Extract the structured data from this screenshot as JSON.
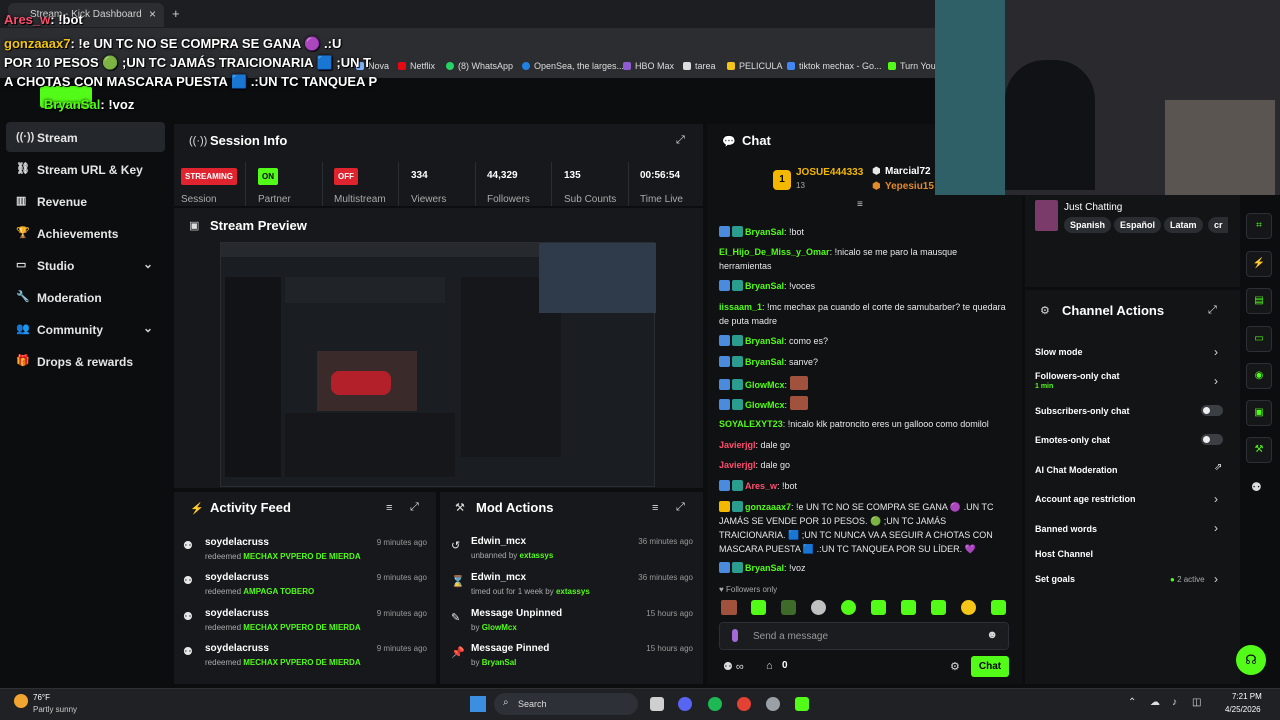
{
  "browser": {
    "tab_title": "Stream - Kick Dashboard",
    "new_tab": "+",
    "close_tab": "×",
    "bookmarks": [
      "Nova",
      "Netflix",
      "(8) WhatsApp",
      "OpenSea, the larges...",
      "HBO Max",
      "tarea",
      "PELICULA",
      "tiktok mechax - Go...",
      "Turn You"
    ]
  },
  "overlay_chat": [
    {
      "name": "Ares_w",
      "text": ": !bot"
    },
    {
      "name": "gonzaaax7",
      "text": ": !e UN TC NO SE COMPRA SE GANA 🟣 .:U"
    },
    {
      "name": "",
      "text": "POR 10 PESOS 🟢 ;UN TC JAMÁS TRAICIONARIA 🟦 ;UN T"
    },
    {
      "name": "",
      "text": "A CHOTAS CON MASCARA PUESTA 🟦 .:UN TC TANQUEA P"
    },
    {
      "name": "BryanSal",
      "text": ": !voz"
    }
  ],
  "sidebar": {
    "items": [
      {
        "label": "Stream",
        "icon": "broadcast-icon",
        "active": true
      },
      {
        "label": "Stream URL & Key",
        "icon": "link-icon"
      },
      {
        "label": "Revenue",
        "icon": "chart-icon"
      },
      {
        "label": "Achievements",
        "icon": "trophy-icon"
      },
      {
        "label": "Studio",
        "icon": "monitor-icon",
        "chevron": true
      },
      {
        "label": "Moderation",
        "icon": "wrench-icon"
      },
      {
        "label": "Community",
        "icon": "people-icon",
        "chevron": true
      },
      {
        "label": "Drops & rewards",
        "icon": "gift-icon"
      }
    ]
  },
  "session_info": {
    "title": "Session Info",
    "session_badge": "STREAMING",
    "session_label": "Session",
    "partner_badge": "ON",
    "partner_label": "Partner",
    "multistream_badge": "OFF",
    "multistream_label": "Multistream",
    "viewers": "334",
    "viewers_label": "Viewers",
    "followers": "44,329",
    "followers_label": "Followers",
    "subs": "135",
    "subs_label": "Sub Counts",
    "time_live": "00:56:54",
    "time_live_label": "Time Live"
  },
  "stream_preview": {
    "title": "Stream Preview"
  },
  "activity_feed": {
    "title": "Activity Feed",
    "items": [
      {
        "user": "soydelacruss",
        "action": "redeemed",
        "reward": "MECHAX PVPERO DE MIERDA",
        "time": "9 minutes ago"
      },
      {
        "user": "soydelacruss",
        "action": "redeemed",
        "reward": "AMPAGA TOBERO",
        "time": "9 minutes ago"
      },
      {
        "user": "soydelacruss",
        "action": "redeemed",
        "reward": "MECHAX PVPERO DE MIERDA",
        "time": "9 minutes ago"
      },
      {
        "user": "soydelacruss",
        "action": "redeemed",
        "reward": "MECHAX PVPERO DE MIERDA",
        "time": "9 minutes ago"
      }
    ]
  },
  "mod_actions": {
    "title": "Mod Actions",
    "items": [
      {
        "title": "Edwin_mcx",
        "detail": "unbanned by",
        "by": "extassys",
        "time": "36 minutes ago",
        "icon": "undo-icon"
      },
      {
        "title": "Edwin_mcx",
        "detail": "timed out for 1 week by",
        "by": "extassys",
        "time": "36 minutes ago",
        "icon": "hourglass-icon"
      },
      {
        "title": "Message Unpinned",
        "detail": "by",
        "by": "GlowMcx",
        "time": "15 hours ago",
        "icon": "unpin-icon"
      },
      {
        "title": "Message Pinned",
        "detail": "by",
        "by": "BryanSal",
        "time": "15 hours ago",
        "icon": "pin-icon"
      }
    ]
  },
  "chat": {
    "title": "Chat",
    "top_gifter": "JOSUE444333",
    "top_gifter_count": "13",
    "top_rank": "1",
    "gifter2": "Marcial72",
    "gifter3": "Yepesiu15",
    "messages": [
      {
        "name": "BryanSal",
        "color": "#53fc18",
        "text": ": !bot",
        "badges": true
      },
      {
        "name": "El_Hijo_De_Miss_y_Omar",
        "color": "#53fc18",
        "text": ": !nicalo se me paro la mausque herramientas",
        "badges": false
      },
      {
        "name": "BryanSal",
        "color": "#53fc18",
        "text": ": !voces",
        "badges": true
      },
      {
        "name": "iissaam_1",
        "color": "#53fc18",
        "text": ": !mc mechax pa cuando el corte de samubarber? te quedara de puta madre",
        "badges": false
      },
      {
        "name": "BryanSal",
        "color": "#53fc18",
        "text": ": como es?",
        "badges": true
      },
      {
        "name": "BryanSal",
        "color": "#53fc18",
        "text": ": sanve?",
        "badges": true
      },
      {
        "name": "GlowMcx",
        "color": "#53fc18",
        "text": ":",
        "badges": true
      },
      {
        "name": "GlowMcx",
        "color": "#53fc18",
        "text": ":",
        "badges": true
      },
      {
        "name": "SOYALEXYT23",
        "color": "#53fc18",
        "text": ": !nicalo klk patroncito eres un gallooo como domilol",
        "badges": false
      },
      {
        "name": "Javierjgl",
        "color": "#ff4d6d",
        "text": ": dale go",
        "badges": false
      },
      {
        "name": "Javierjgl",
        "color": "#ff4d6d",
        "text": ": dale go",
        "badges": false
      },
      {
        "name": "Ares_w",
        "color": "#ff4d6d",
        "text": ": !bot",
        "badges": true
      },
      {
        "name": "gonzaaax7",
        "color": "#53fc18",
        "text": ": !e UN TC NO SE COMPRA SE GANA 🟣 .UN TC JAMÁS SE VENDE POR 10 PESOS. 🟢 ;UN TC JAMÁS TRAICIONARIA. 🟦 ;UN TC NUNCA VA A SEGUIR A CHOTAS CON MASCARA PUESTA 🟦 .:UN TC TANQUEA POR SU LÍDER. 💜",
        "badges": true
      },
      {
        "name": "BryanSal",
        "color": "#53fc18",
        "text": ": !voz",
        "badges": true
      }
    ],
    "followers_only": "Followers only",
    "input_placeholder": "Send a message",
    "count_zero": "0",
    "send_label": "Chat"
  },
  "category": {
    "name": "Just Chatting",
    "tags": [
      "Spanish",
      "Español",
      "Latam",
      "cr"
    ]
  },
  "channel_actions": {
    "title": "Channel Actions",
    "items": [
      {
        "label": "Slow mode",
        "kind": "arrow"
      },
      {
        "label": "Followers-only chat",
        "sub": "1 min",
        "kind": "arrow"
      },
      {
        "label": "Subscribers-only chat",
        "kind": "toggle"
      },
      {
        "label": "Emotes-only chat",
        "kind": "toggle"
      },
      {
        "label": "AI Chat Moderation",
        "kind": "external"
      },
      {
        "label": "Account age restriction",
        "kind": "arrow"
      },
      {
        "label": "Banned words",
        "kind": "arrow"
      },
      {
        "label": "Host Channel",
        "kind": "none"
      },
      {
        "label": "Set goals",
        "sub": "2 active",
        "kind": "arrow"
      }
    ]
  },
  "taskbar": {
    "weather_temp": "76°F",
    "weather_text": "Partly sunny",
    "search": "Search",
    "time": "7:21 PM",
    "date": "4/25/2026"
  },
  "colors": {
    "accent": "#53fc18",
    "streaming": "#e0242f",
    "on": "#53fc18",
    "off": "#e0242f"
  }
}
